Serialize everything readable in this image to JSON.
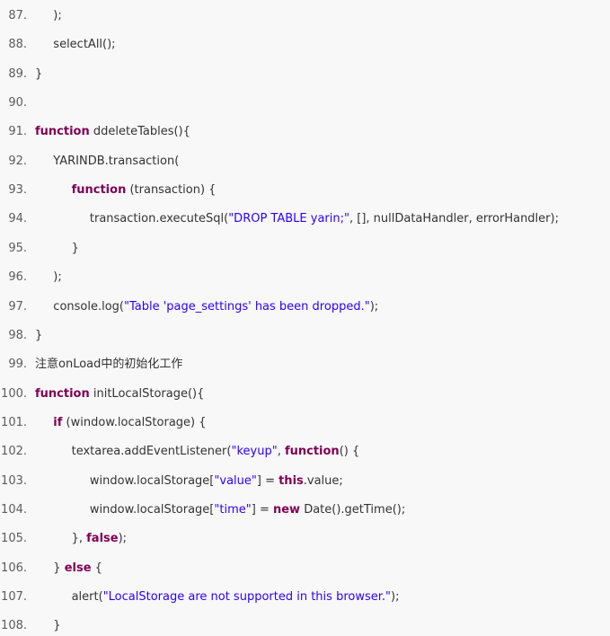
{
  "lines": [
    {
      "number": "87.",
      "indent": 1,
      "tokens": [
        {
          "t": ");",
          "k": "plain"
        }
      ]
    },
    {
      "number": "88.",
      "indent": 1,
      "tokens": [
        {
          "t": "selectAll();",
          "k": "plain"
        }
      ]
    },
    {
      "number": "89.",
      "indent": 0,
      "tokens": [
        {
          "t": "}",
          "k": "plain"
        }
      ]
    },
    {
      "number": "90.",
      "indent": 0,
      "tokens": []
    },
    {
      "number": "91.",
      "indent": 0,
      "tokens": [
        {
          "t": "function",
          "k": "keyword"
        },
        {
          "t": " ddeleteTables(){",
          "k": "plain"
        }
      ]
    },
    {
      "number": "92.",
      "indent": 1,
      "tokens": [
        {
          "t": "YARINDB.transaction(",
          "k": "plain"
        }
      ]
    },
    {
      "number": "93.",
      "indent": 2,
      "tokens": [
        {
          "t": "function",
          "k": "keyword"
        },
        {
          "t": " (transaction) {",
          "k": "plain"
        }
      ]
    },
    {
      "number": "94.",
      "indent": 3,
      "tokens": [
        {
          "t": "transaction.executeSql(",
          "k": "plain"
        },
        {
          "t": "\"DROP TABLE yarin;\"",
          "k": "string"
        },
        {
          "t": ", [], nullDataHandler, errorHandler);",
          "k": "plain"
        }
      ]
    },
    {
      "number": "95.",
      "indent": 2,
      "tokens": [
        {
          "t": "}",
          "k": "plain"
        }
      ]
    },
    {
      "number": "96.",
      "indent": 1,
      "tokens": [
        {
          "t": ");",
          "k": "plain"
        }
      ]
    },
    {
      "number": "97.",
      "indent": 1,
      "tokens": [
        {
          "t": "console.log(",
          "k": "plain"
        },
        {
          "t": "\"Table 'page_settings' has been dropped.\"",
          "k": "string"
        },
        {
          "t": ");",
          "k": "plain"
        }
      ]
    },
    {
      "number": "98.",
      "indent": 0,
      "tokens": [
        {
          "t": "}",
          "k": "plain"
        }
      ]
    },
    {
      "number": "99.",
      "indent": 0,
      "tokens": [
        {
          "t": "注意onLoad中的初始化工作",
          "k": "plain"
        }
      ]
    },
    {
      "number": "100.",
      "indent": 0,
      "tokens": [
        {
          "t": "function",
          "k": "keyword"
        },
        {
          "t": " initLocalStorage(){",
          "k": "plain"
        }
      ]
    },
    {
      "number": "101.",
      "indent": 1,
      "tokens": [
        {
          "t": "if",
          "k": "keyword"
        },
        {
          "t": " (window.localStorage) {",
          "k": "plain"
        }
      ]
    },
    {
      "number": "102.",
      "indent": 2,
      "tokens": [
        {
          "t": "textarea.addEventListener(",
          "k": "plain"
        },
        {
          "t": "\"keyup\"",
          "k": "string"
        },
        {
          "t": ", ",
          "k": "plain"
        },
        {
          "t": "function",
          "k": "keyword"
        },
        {
          "t": "() {",
          "k": "plain"
        }
      ]
    },
    {
      "number": "103.",
      "indent": 3,
      "tokens": [
        {
          "t": "window.localStorage[",
          "k": "plain"
        },
        {
          "t": "\"value\"",
          "k": "string"
        },
        {
          "t": "] = ",
          "k": "plain"
        },
        {
          "t": "this",
          "k": "keyword"
        },
        {
          "t": ".value;",
          "k": "plain"
        }
      ]
    },
    {
      "number": "104.",
      "indent": 3,
      "tokens": [
        {
          "t": "window.localStorage[",
          "k": "plain"
        },
        {
          "t": "\"time\"",
          "k": "string"
        },
        {
          "t": "] = ",
          "k": "plain"
        },
        {
          "t": "new",
          "k": "keyword"
        },
        {
          "t": " Date().getTime();",
          "k": "plain"
        }
      ]
    },
    {
      "number": "105.",
      "indent": 2,
      "tokens": [
        {
          "t": "}, ",
          "k": "plain"
        },
        {
          "t": "false",
          "k": "keyword"
        },
        {
          "t": ");",
          "k": "plain"
        }
      ]
    },
    {
      "number": "106.",
      "indent": 1,
      "tokens": [
        {
          "t": "} ",
          "k": "plain"
        },
        {
          "t": "else",
          "k": "keyword"
        },
        {
          "t": " {",
          "k": "plain"
        }
      ]
    },
    {
      "number": "107.",
      "indent": 2,
      "tokens": [
        {
          "t": "alert(",
          "k": "plain"
        },
        {
          "t": "\"LocalStorage are not supported in this browser.\"",
          "k": "string"
        },
        {
          "t": ");",
          "k": "plain"
        }
      ]
    },
    {
      "number": "108.",
      "indent": 1,
      "tokens": [
        {
          "t": "}",
          "k": "plain"
        }
      ]
    }
  ]
}
